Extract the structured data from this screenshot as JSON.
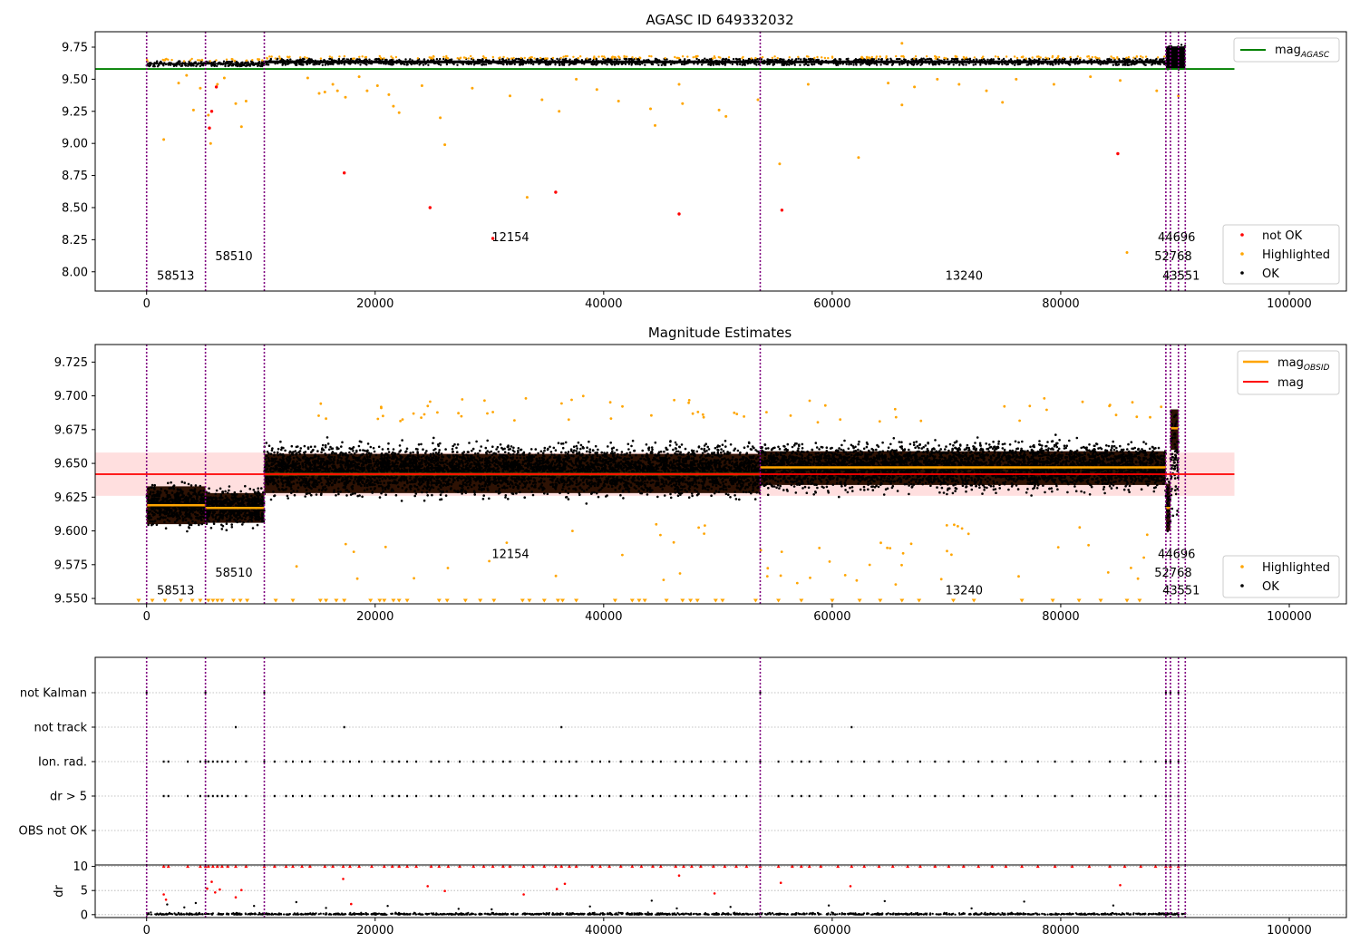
{
  "figure": {
    "title": "AGASC ID 649332032",
    "colors": {
      "ok": "#000000",
      "highlighted": "#ffa500",
      "not_ok": "#ff0000",
      "obs_boundary": "#800080",
      "agasc_line": "#008000",
      "mag_line": "#ff0000",
      "mag_band": "#ffdfdf",
      "grid": "#b0b0b0"
    }
  },
  "chart_data": [
    {
      "type": "scatter",
      "title": "AGASC ID 649332032",
      "xlim": [
        -4500,
        105000
      ],
      "ylim": [
        7.85,
        9.87
      ],
      "x_ticks": [
        0,
        20000,
        40000,
        60000,
        80000,
        100000
      ],
      "x_tick_labels": [
        "0",
        "20000",
        "40000",
        "60000",
        "80000",
        "100000"
      ],
      "y_ticks": [
        8.0,
        8.25,
        8.5,
        8.75,
        9.0,
        9.25,
        9.5,
        9.75
      ],
      "y_tick_labels": [
        "8.00",
        "8.25",
        "8.50",
        "8.75",
        "9.00",
        "9.25",
        "9.50",
        "9.75"
      ],
      "legend_top": {
        "position": "top-right",
        "entries": [
          {
            "label": "mag",
            "subscript": "AGASC",
            "color": "#008000",
            "marker": "line"
          }
        ]
      },
      "legend_bottom": {
        "position": "bottom-right",
        "entries": [
          {
            "label": "not OK",
            "color": "#ff0000",
            "marker": "dot"
          },
          {
            "label": "Highlighted",
            "color": "#ffa500",
            "marker": "dot"
          },
          {
            "label": "OK",
            "color": "#000000",
            "marker": "dot"
          }
        ]
      },
      "hlines": [
        {
          "name": "mag_AGASC",
          "y": 9.58,
          "x": [
            -4500,
            95200
          ],
          "color": "#008000"
        }
      ],
      "obs_boundaries": [
        0,
        5150,
        10300,
        53700,
        89200,
        89600,
        90300,
        90900
      ],
      "obs_labels": [
        {
          "text": "58513",
          "x": 900,
          "y": 7.94
        },
        {
          "text": "58510",
          "x": 6000,
          "y": 8.09
        },
        {
          "text": "12154",
          "x": 30200,
          "y": 8.24
        },
        {
          "text": "13240",
          "x": 69900,
          "y": 7.94
        },
        {
          "text": "44696",
          "x": 88500,
          "y": 8.24
        },
        {
          "text": "52768",
          "x": 88200,
          "y": 8.09
        },
        {
          "text": "43551",
          "x": 88900,
          "y": 7.94
        }
      ],
      "bands": [
        {
          "x": [
            0,
            10300
          ],
          "center": 9.62,
          "width": 0.014
        },
        {
          "x": [
            10300,
            89200
          ],
          "center": 9.637,
          "width": 0.012
        },
        {
          "x": [
            89200,
            90900
          ],
          "center": 9.64,
          "width": 0.06
        }
      ],
      "highlighted_points": [
        [
          1500,
          9.03
        ],
        [
          2800,
          9.47
        ],
        [
          3500,
          9.53
        ],
        [
          4100,
          9.26
        ],
        [
          4700,
          9.43
        ],
        [
          5400,
          9.22
        ],
        [
          5600,
          9.0
        ],
        [
          6200,
          9.46
        ],
        [
          6800,
          9.51
        ],
        [
          7800,
          9.31
        ],
        [
          8300,
          9.13
        ],
        [
          8700,
          9.33
        ],
        [
          14100,
          9.51
        ],
        [
          15100,
          9.39
        ],
        [
          15600,
          9.4
        ],
        [
          16300,
          9.46
        ],
        [
          16700,
          9.41
        ],
        [
          17400,
          9.36
        ],
        [
          18600,
          9.52
        ],
        [
          19300,
          9.41
        ],
        [
          20200,
          9.45
        ],
        [
          21200,
          9.38
        ],
        [
          21600,
          9.29
        ],
        [
          22100,
          9.24
        ],
        [
          24100,
          9.45
        ],
        [
          25700,
          9.2
        ],
        [
          26100,
          8.99
        ],
        [
          28500,
          9.43
        ],
        [
          31800,
          9.37
        ],
        [
          33300,
          8.58
        ],
        [
          34600,
          9.34
        ],
        [
          36100,
          9.25
        ],
        [
          37600,
          9.5
        ],
        [
          39400,
          9.42
        ],
        [
          41300,
          9.33
        ],
        [
          44100,
          9.27
        ],
        [
          44500,
          9.14
        ],
        [
          46600,
          9.46
        ],
        [
          46900,
          9.31
        ],
        [
          50100,
          9.26
        ],
        [
          50700,
          9.21
        ],
        [
          53500,
          9.34
        ],
        [
          55400,
          8.84
        ],
        [
          57900,
          9.46
        ],
        [
          62300,
          8.89
        ],
        [
          64900,
          9.47
        ],
        [
          66100,
          9.3
        ],
        [
          67200,
          9.44
        ],
        [
          69200,
          9.5
        ],
        [
          71100,
          9.46
        ],
        [
          73500,
          9.41
        ],
        [
          74900,
          9.32
        ],
        [
          76100,
          9.5
        ],
        [
          79400,
          9.46
        ],
        [
          82600,
          9.52
        ],
        [
          85200,
          9.49
        ],
        [
          85800,
          8.15
        ],
        [
          88400,
          9.41
        ],
        [
          90300,
          9.37
        ],
        [
          66100,
          9.78
        ]
      ],
      "not_ok_points": [
        [
          5500,
          9.12
        ],
        [
          5700,
          9.25
        ],
        [
          6100,
          9.44
        ],
        [
          17300,
          8.77
        ],
        [
          24800,
          8.5
        ],
        [
          30300,
          8.26
        ],
        [
          35800,
          8.62
        ],
        [
          46600,
          8.45
        ],
        [
          55600,
          8.48
        ],
        [
          85000,
          8.92
        ]
      ],
      "ok_band": [
        {
          "x": [
            0,
            10300
          ],
          "y": [
            9.6,
            9.64
          ]
        },
        {
          "x": [
            10300,
            89200
          ],
          "y": [
            9.61,
            9.66
          ]
        },
        {
          "x": [
            89200,
            90900
          ],
          "y": [
            9.57,
            9.77
          ]
        }
      ]
    },
    {
      "type": "scatter",
      "title": "Magnitude Estimates",
      "xlim": [
        -4500,
        105000
      ],
      "ylim": [
        9.546,
        9.738
      ],
      "x_ticks": [
        0,
        20000,
        40000,
        60000,
        80000,
        100000
      ],
      "x_tick_labels": [
        "0",
        "20000",
        "40000",
        "60000",
        "80000",
        "100000"
      ],
      "y_ticks": [
        9.55,
        9.575,
        9.6,
        9.625,
        9.65,
        9.675,
        9.7,
        9.725
      ],
      "y_tick_labels": [
        "9.550",
        "9.575",
        "9.600",
        "9.625",
        "9.650",
        "9.675",
        "9.700",
        "9.725"
      ],
      "legend_top": {
        "position": "top-right",
        "entries": [
          {
            "label": "mag",
            "subscript": "OBSID",
            "color": "#ffa500",
            "marker": "line"
          },
          {
            "label": "mag",
            "subscript": "",
            "color": "#ff0000",
            "marker": "line"
          }
        ]
      },
      "legend_bottom": {
        "position": "bottom-right",
        "entries": [
          {
            "label": "Highlighted",
            "color": "#ffa500",
            "marker": "dot"
          },
          {
            "label": "OK",
            "color": "#000000",
            "marker": "dot"
          }
        ]
      },
      "mag_line": {
        "y": 9.642,
        "x": [
          -4500,
          95200
        ],
        "band": [
          9.626,
          9.658
        ]
      },
      "obs_boundaries": [
        0,
        5150,
        10300,
        53700,
        89200,
        89600,
        90300,
        90900
      ],
      "obs_labels": [
        {
          "text": "58513",
          "x": 900,
          "y": 9.553
        },
        {
          "text": "58510",
          "x": 6000,
          "y": 9.566
        },
        {
          "text": "12154",
          "x": 30200,
          "y": 9.58
        },
        {
          "text": "13240",
          "x": 69900,
          "y": 9.553
        },
        {
          "text": "44696",
          "x": 88500,
          "y": 9.58
        },
        {
          "text": "52768",
          "x": 88200,
          "y": 9.566
        },
        {
          "text": "43551",
          "x": 88900,
          "y": 9.553
        }
      ],
      "obs_segments": [
        {
          "x": [
            0,
            5150
          ],
          "mag": 9.619,
          "y_band": [
            9.605,
            9.633
          ],
          "ok_range": [
            9.59,
            9.648
          ]
        },
        {
          "x": [
            5150,
            10300
          ],
          "mag": 9.617,
          "y_band": [
            9.606,
            9.628
          ],
          "ok_range": [
            9.592,
            9.643
          ]
        },
        {
          "x": [
            10300,
            53700
          ],
          "mag": 9.642,
          "y_band": [
            9.628,
            9.657
          ],
          "ok_range": [
            9.61,
            9.68
          ]
        },
        {
          "x": [
            53700,
            89200
          ],
          "mag": 9.647,
          "y_band": [
            9.634,
            9.659
          ],
          "ok_range": [
            9.615,
            9.68
          ]
        },
        {
          "x": [
            89200,
            89600
          ],
          "mag": 9.617,
          "y_band": [
            9.6,
            9.635
          ],
          "ok_range": [
            9.58,
            9.66
          ]
        },
        {
          "x": [
            89600,
            90300
          ],
          "mag": 9.676,
          "y_band": [
            9.66,
            9.69
          ],
          "ok_range": [
            9.57,
            9.738
          ]
        }
      ],
      "low_markers_x": [
        -700,
        500,
        1600,
        3000,
        4000,
        4700,
        5400,
        5800,
        6200,
        6600,
        7600,
        8200,
        8800,
        11300,
        12800,
        15200,
        15700,
        16600,
        17300,
        19600,
        20400,
        20800,
        21600,
        22100,
        22800,
        25600,
        26300,
        27900,
        29200,
        30400,
        32900,
        33500,
        34800,
        36000,
        36400,
        37600,
        41000,
        42500,
        43100,
        43600,
        45500,
        46900,
        47600,
        48200,
        49800,
        50400,
        53300,
        55300,
        57300,
        60000,
        62400,
        64200,
        66100,
        67600,
        70600,
        72400,
        76600,
        79300,
        81600,
        83500,
        85800,
        86900
      ]
    },
    {
      "type": "scatter",
      "title": "",
      "xlim": [
        -4500,
        105000
      ],
      "categories": [
        "not Kalman",
        "not track",
        "Ion. rad.",
        "dr > 5",
        "OBS not OK"
      ],
      "obs_boundaries": [
        0,
        5150,
        10300,
        53700,
        89200,
        89600,
        90300,
        90900
      ],
      "flag_points": {
        "not Kalman": [
          0,
          5150,
          10300,
          53700,
          89200,
          89600,
          90300
        ],
        "not track": [
          7800,
          17300,
          36300,
          61700
        ],
        "Ion. rad.": [
          1500,
          1900,
          3600,
          4700,
          5150,
          5400,
          5800,
          6200,
          6600,
          7100,
          7800,
          8700,
          10300,
          11200,
          12200,
          12800,
          13600,
          14300,
          15600,
          16300,
          17200,
          17800,
          18600,
          19700,
          20800,
          21500,
          22100,
          22800,
          23600,
          24900,
          25600,
          26400,
          27400,
          28600,
          29500,
          30300,
          31200,
          31800,
          33000,
          33800,
          34800,
          35800,
          36300,
          37000,
          37600,
          39000,
          39700,
          40500,
          41500,
          42500,
          43300,
          44300,
          45000,
          46300,
          47000,
          47700,
          48500,
          49600,
          50600,
          51600,
          52500,
          53700,
          55300,
          56500,
          57300,
          58000,
          59000,
          60500,
          61700,
          62800,
          64100,
          65300,
          66600,
          67700,
          69000,
          70200,
          71500,
          72800,
          74000,
          75200,
          76600,
          78000,
          79500,
          81000,
          82500,
          84300,
          85600,
          87000,
          88300,
          89200,
          89600,
          90300
        ],
        "dr > 5": [
          1500,
          1900,
          3600,
          4700,
          5150,
          5400,
          5800,
          6200,
          6600,
          7100,
          7800,
          8700,
          10300,
          11200,
          12200,
          12800,
          13600,
          14300,
          15600,
          16300,
          17200,
          17800,
          18600,
          19700,
          20800,
          21500,
          22100,
          22800,
          23600,
          24900,
          25600,
          26400,
          27400,
          28600,
          29500,
          30300,
          31200,
          31800,
          33000,
          33800,
          34800,
          35800,
          36300,
          37000,
          37600,
          39000,
          39700,
          40500,
          41500,
          42500,
          43300,
          44300,
          45000,
          46300,
          47000,
          47700,
          48500,
          49600,
          50600,
          51600,
          52500,
          53700,
          55300,
          56500,
          57300,
          58000,
          59000,
          60500,
          61700,
          62800,
          64100,
          65300,
          66600,
          67700,
          69000,
          70200,
          71500,
          72800,
          74000,
          75200,
          76600,
          78000,
          79500,
          81000,
          82500,
          84300,
          85600,
          87000,
          88300,
          89200,
          89600,
          90300
        ],
        "OBS not OK": []
      }
    },
    {
      "type": "scatter",
      "title": "",
      "ylabel": "dr",
      "xlim": [
        -4500,
        105000
      ],
      "ylim": [
        -0.6,
        10.3
      ],
      "x_ticks": [
        0,
        20000,
        40000,
        60000,
        80000,
        100000
      ],
      "x_tick_labels": [
        "0",
        "20000",
        "40000",
        "60000",
        "80000",
        "100000"
      ],
      "y_ticks": [
        0,
        5,
        10
      ],
      "y_tick_labels": [
        "0",
        "5",
        "10"
      ],
      "obs_boundaries": [
        0,
        5150,
        10300,
        53700,
        89200,
        89600,
        90300,
        90900
      ],
      "saturated_y": 10,
      "red_points": [
        [
          1500,
          4.2
        ],
        [
          1700,
          3.1
        ],
        [
          5300,
          5.4
        ],
        [
          5700,
          6.8
        ],
        [
          6000,
          4.6
        ],
        [
          6400,
          5.2
        ],
        [
          7800,
          3.6
        ],
        [
          8300,
          5.1
        ],
        [
          17200,
          7.4
        ],
        [
          17900,
          2.2
        ],
        [
          24600,
          5.9
        ],
        [
          26100,
          4.9
        ],
        [
          33000,
          4.2
        ],
        [
          35900,
          5.3
        ],
        [
          36600,
          6.4
        ],
        [
          46600,
          8.1
        ],
        [
          49700,
          4.4
        ],
        [
          55500,
          6.6
        ],
        [
          61600,
          5.9
        ],
        [
          85200,
          6.1
        ]
      ],
      "black_outliers": [
        [
          1800,
          2.1
        ],
        [
          3300,
          1.5
        ],
        [
          4300,
          2.4
        ],
        [
          9400,
          1.8
        ],
        [
          13100,
          2.6
        ],
        [
          15700,
          1.4
        ],
        [
          21100,
          1.8
        ],
        [
          27300,
          1.2
        ],
        [
          30200,
          1.1
        ],
        [
          38800,
          1.7
        ],
        [
          44200,
          2.9
        ],
        [
          46400,
          1.3
        ],
        [
          51100,
          1.6
        ],
        [
          59700,
          1.9
        ],
        [
          64600,
          2.8
        ],
        [
          72200,
          1.3
        ],
        [
          76800,
          2.7
        ],
        [
          84600,
          1.9
        ]
      ]
    }
  ]
}
